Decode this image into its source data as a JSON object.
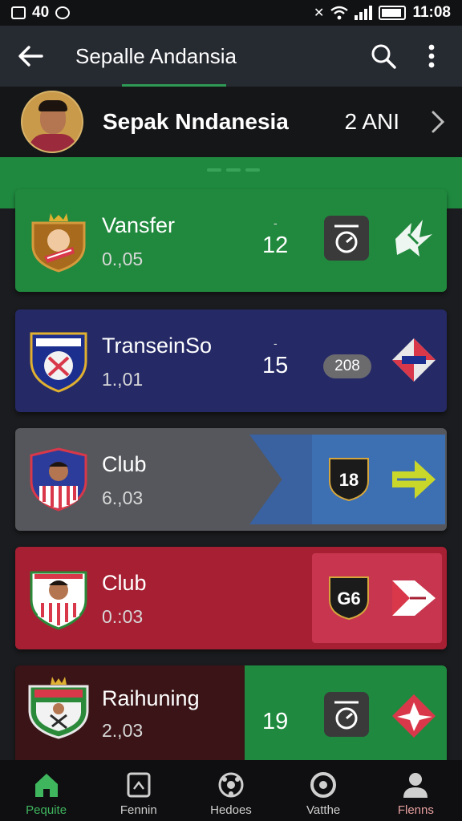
{
  "status_bar": {
    "left_text": "40",
    "time": "11:08"
  },
  "app_bar": {
    "title": "Sepalle Andansia"
  },
  "profile": {
    "name": "Sepak Nndanesia",
    "count": "2 ANI"
  },
  "cards": [
    {
      "name": "Vansfer",
      "value": "0.,05",
      "number": "12",
      "dot": "-"
    },
    {
      "name": "TranseinSo",
      "value": "1.,01",
      "number": "15",
      "dot": "-",
      "badge_text": "208"
    },
    {
      "name": "Club",
      "value": "6.,03",
      "badge_text": "18"
    },
    {
      "name": "Club",
      "value": "0.:03",
      "badge_text": "G6"
    },
    {
      "name": "Raihuning",
      "value": "2.,03",
      "number": "19"
    }
  ],
  "bottom_nav": [
    {
      "label": "Pequite",
      "icon": "home-icon",
      "active": true
    },
    {
      "label": "Fennin",
      "icon": "square-icon",
      "active": false
    },
    {
      "label": "Hedoes",
      "icon": "ball-icon",
      "active": false
    },
    {
      "label": "Vatthe",
      "icon": "target-icon",
      "active": false
    },
    {
      "label": "Flenns",
      "icon": "person-icon",
      "active": false
    }
  ],
  "colors": {
    "card1": "#21893e",
    "card2": "#252a66",
    "card3": "#55575c",
    "card4": "#a61f32",
    "card5": "#3a1417",
    "accent": "#3fb55e"
  }
}
